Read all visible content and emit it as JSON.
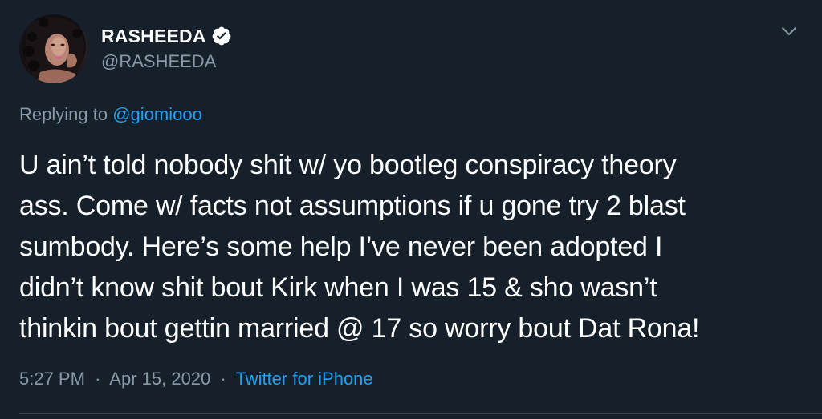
{
  "tweet": {
    "author": {
      "display_name": "RASHEEDA",
      "handle": "@RASHEEDA",
      "verified": true,
      "avatar_icon": "profile-photo"
    },
    "more_menu_icon": "chevron-down-icon",
    "replying_to": {
      "prefix": "Replying to",
      "handle": "@giomiooo"
    },
    "text_lines": [
      "U ain’t told nobody shit w/ yo bootleg conspiracy theory",
      "ass. Come w/ facts not assumptions if u gone try 2 blast",
      "sumbody. Here’s some help I’ve never been adopted I",
      "didn’t know shit bout Kirk when I was 15 & sho wasn’t",
      "thinkin bout gettin married @ 17 so worry bout Dat Rona!"
    ],
    "meta": {
      "time": "5:27 PM",
      "separator": "·",
      "date": "Apr 15, 2020",
      "source": "Twitter for iPhone"
    }
  },
  "colors": {
    "background": "#15202b",
    "primary_text": "#ffffff",
    "secondary_text": "#8899a6",
    "link": "#1da1f2",
    "divider": "#38444d"
  }
}
